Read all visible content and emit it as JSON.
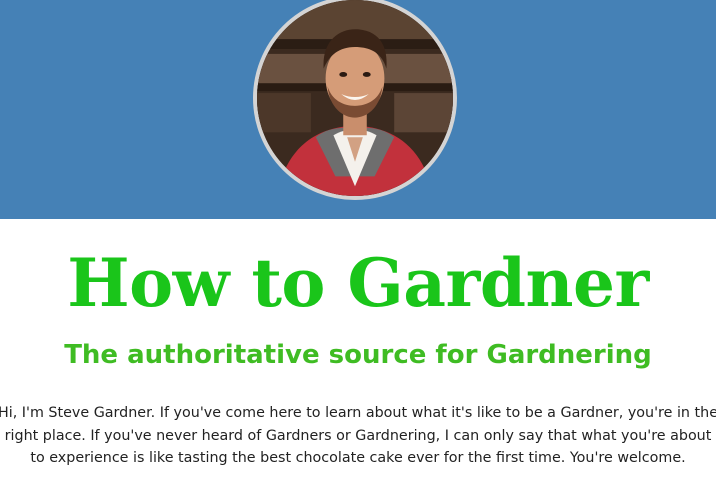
{
  "header": {
    "background_color": "#4581b6",
    "avatar_icon": "profile-photo"
  },
  "main": {
    "title": "How to Gardner",
    "title_color": "#1ac51a",
    "subtitle": "The authoritative source for Gardnering",
    "subtitle_color": "#3fbc23",
    "intro": "Hi, I'm Steve Gardner. If you've come here to learn about what it's like to be a Gardner, you're in the right place. If you've never heard of Gardners or Gardnering, I can only say that what you're about to experience is like tasting the best chocolate cake ever for the first time. You're welcome."
  }
}
